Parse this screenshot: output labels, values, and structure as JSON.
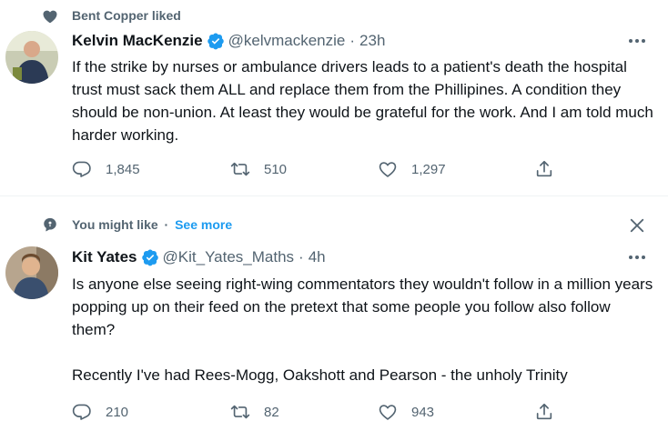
{
  "tweet1": {
    "context": "Bent Copper liked",
    "name": "Kelvin MacKenzie",
    "handle": "@kelvmackenzie",
    "time": "23h",
    "text": "If the strike by nurses or ambulance drivers leads to a patient's death the hospital trust must sack them ALL and replace them from the Phillipines. A condition they should be non-union. At least they would be grateful for the work. And I am told much harder working.",
    "replies": "1,845",
    "retweets": "510",
    "likes": "1,297"
  },
  "tweet2": {
    "context": "You might like",
    "context_dot": "·",
    "see_more": "See more",
    "name": "Kit Yates",
    "handle": "@Kit_Yates_Maths",
    "time": "4h",
    "text": "Is anyone else seeing right-wing commentators they wouldn't follow in a million years popping up on their feed on the pretext that some people you follow also follow them?\n\nRecently I've had Rees-Mogg, Oakshott and Pearson - the unholy Trinity",
    "replies": "210",
    "retweets": "82",
    "likes": "943"
  },
  "separator": "·",
  "icons": {
    "context_like": "heart-icon",
    "context_suggest": "speech-bubble-icon",
    "verified": "verified-badge-icon",
    "more": "more-dots-icon",
    "reply": "reply-icon",
    "retweet": "retweet-icon",
    "like": "like-icon",
    "share": "share-icon",
    "close": "close-icon"
  },
  "colors": {
    "accent": "#1d9bf0",
    "secondary_text": "#536471",
    "primary_text": "#0f1419",
    "divider": "#eff3f4"
  }
}
